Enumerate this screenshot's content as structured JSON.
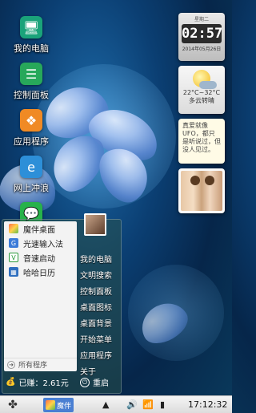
{
  "desktop": {
    "icons": [
      {
        "label": "我的电脑"
      },
      {
        "label": "控制面板"
      },
      {
        "label": "应用程序"
      },
      {
        "label": "网上冲浪"
      },
      {
        "label": ""
      }
    ]
  },
  "widgets": {
    "clock": {
      "weekday": "星期二",
      "time": "02:57",
      "date": "2014年05月26日"
    },
    "weather": {
      "temp": "22°C~32°C",
      "condition": "多云转晴"
    },
    "note": {
      "text": "真爱就像UFO，都只是听说过，但没人见过。"
    }
  },
  "start_menu": {
    "recent": [
      {
        "label": "魔伴桌面",
        "icon": "mobanzhuomian-icon"
      },
      {
        "label": "光速输入法",
        "icon": "input-method-icon"
      },
      {
        "label": "音速启动",
        "icon": "vstart-icon"
      },
      {
        "label": "哈哈日历",
        "icon": "calendar-icon"
      }
    ],
    "all_programs": "所有程序",
    "links": [
      "我的电脑",
      "文明搜索",
      "控制面板",
      "桌面图标",
      "桌面背景",
      "开始菜单",
      "应用程序",
      "关于"
    ],
    "earned": "已赚：2.61元",
    "restart": "重启"
  },
  "taskbar": {
    "task_label": "魔伴",
    "time": "17:12:32"
  },
  "colors": {
    "accent": "#4a7fd2",
    "icon_green": "#1aa37a",
    "icon_orange": "#f08a24",
    "icon_blue": "#2d8fd8"
  }
}
